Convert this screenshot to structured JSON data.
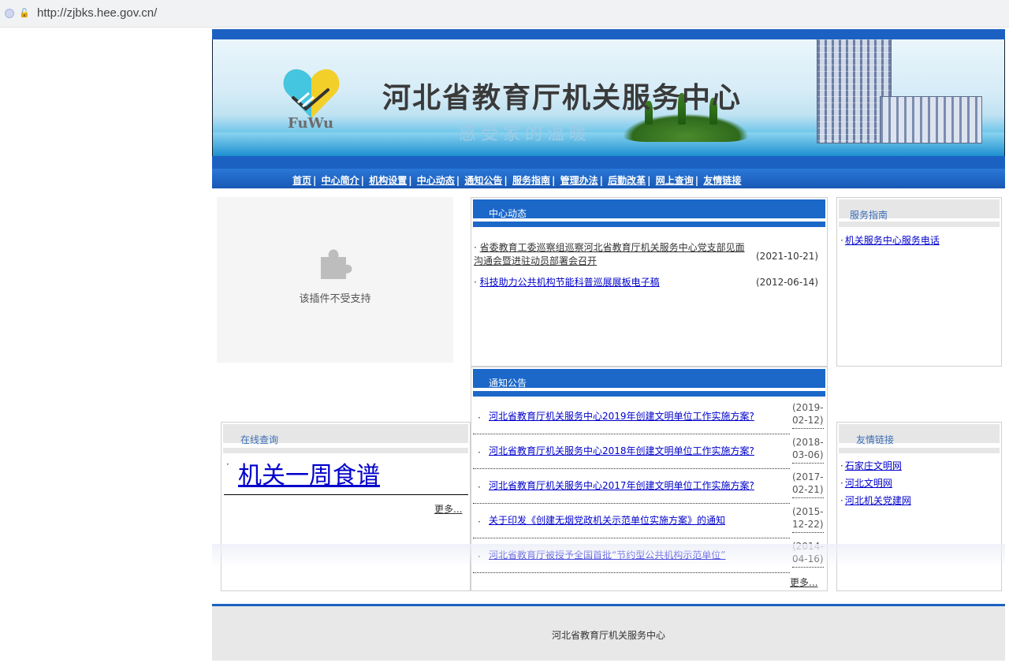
{
  "browser": {
    "url": "http://zjbks.hee.gov.cn/"
  },
  "banner": {
    "title": "河北省教育厅机关服务中心",
    "slogan": "感受家的温暖",
    "logo_text": "FuWu"
  },
  "nav": [
    "首页",
    "中心简介",
    "机构设置",
    "中心动态",
    "通知公告",
    "服务指南",
    "管理办法",
    "后勤改革",
    "网上查询",
    "友情链接"
  ],
  "plugin": {
    "message": "该插件不受支持"
  },
  "center_news": {
    "title": "中心动态",
    "items": [
      {
        "title": "省委教育工委巡察组巡察河北省教育厅机关服务中心党支部见面沟通会暨进驻动员部署会召开",
        "date": "(2021-10-21)"
      },
      {
        "title": "科技助力公共机构节能科普巡展展板电子稿",
        "date": "(2012-06-14)"
      }
    ]
  },
  "service_guide": {
    "title": "服务指南",
    "items": [
      "机关服务中心服务电话"
    ]
  },
  "notices": {
    "title": "通知公告",
    "items": [
      {
        "title": "河北省教育厅机关服务中心2019年创建文明单位工作实施方案?",
        "date": "(2019-02-12)"
      },
      {
        "title": "河北省教育厅机关服务中心2018年创建文明单位工作实施方案?",
        "date": "(2018-03-06)"
      },
      {
        "title": "河北省教育厅机关服务中心2017年创建文明单位工作实施方案?",
        "date": "(2017-02-21)"
      },
      {
        "title": "关于印发《创建无烟党政机关示范单位实施方案》的通知",
        "date": "(2015-12-22)"
      },
      {
        "title": "河北省教育厅被授予全国首批“节约型公共机构示范单位”",
        "date": "(2014-04-16)"
      }
    ],
    "more": "更多..."
  },
  "online_query": {
    "title": "在线查询",
    "link": "机关一周食谱",
    "more": "更多..."
  },
  "friend_links": {
    "title": "友情链接",
    "items": [
      "石家庄文明网",
      "河北文明网",
      "河北机关党建网"
    ]
  },
  "footer": {
    "text": "河北省教育厅机关服务中心"
  },
  "colors": {
    "brand_blue": "#1b61c2",
    "link": "#0000cc"
  }
}
